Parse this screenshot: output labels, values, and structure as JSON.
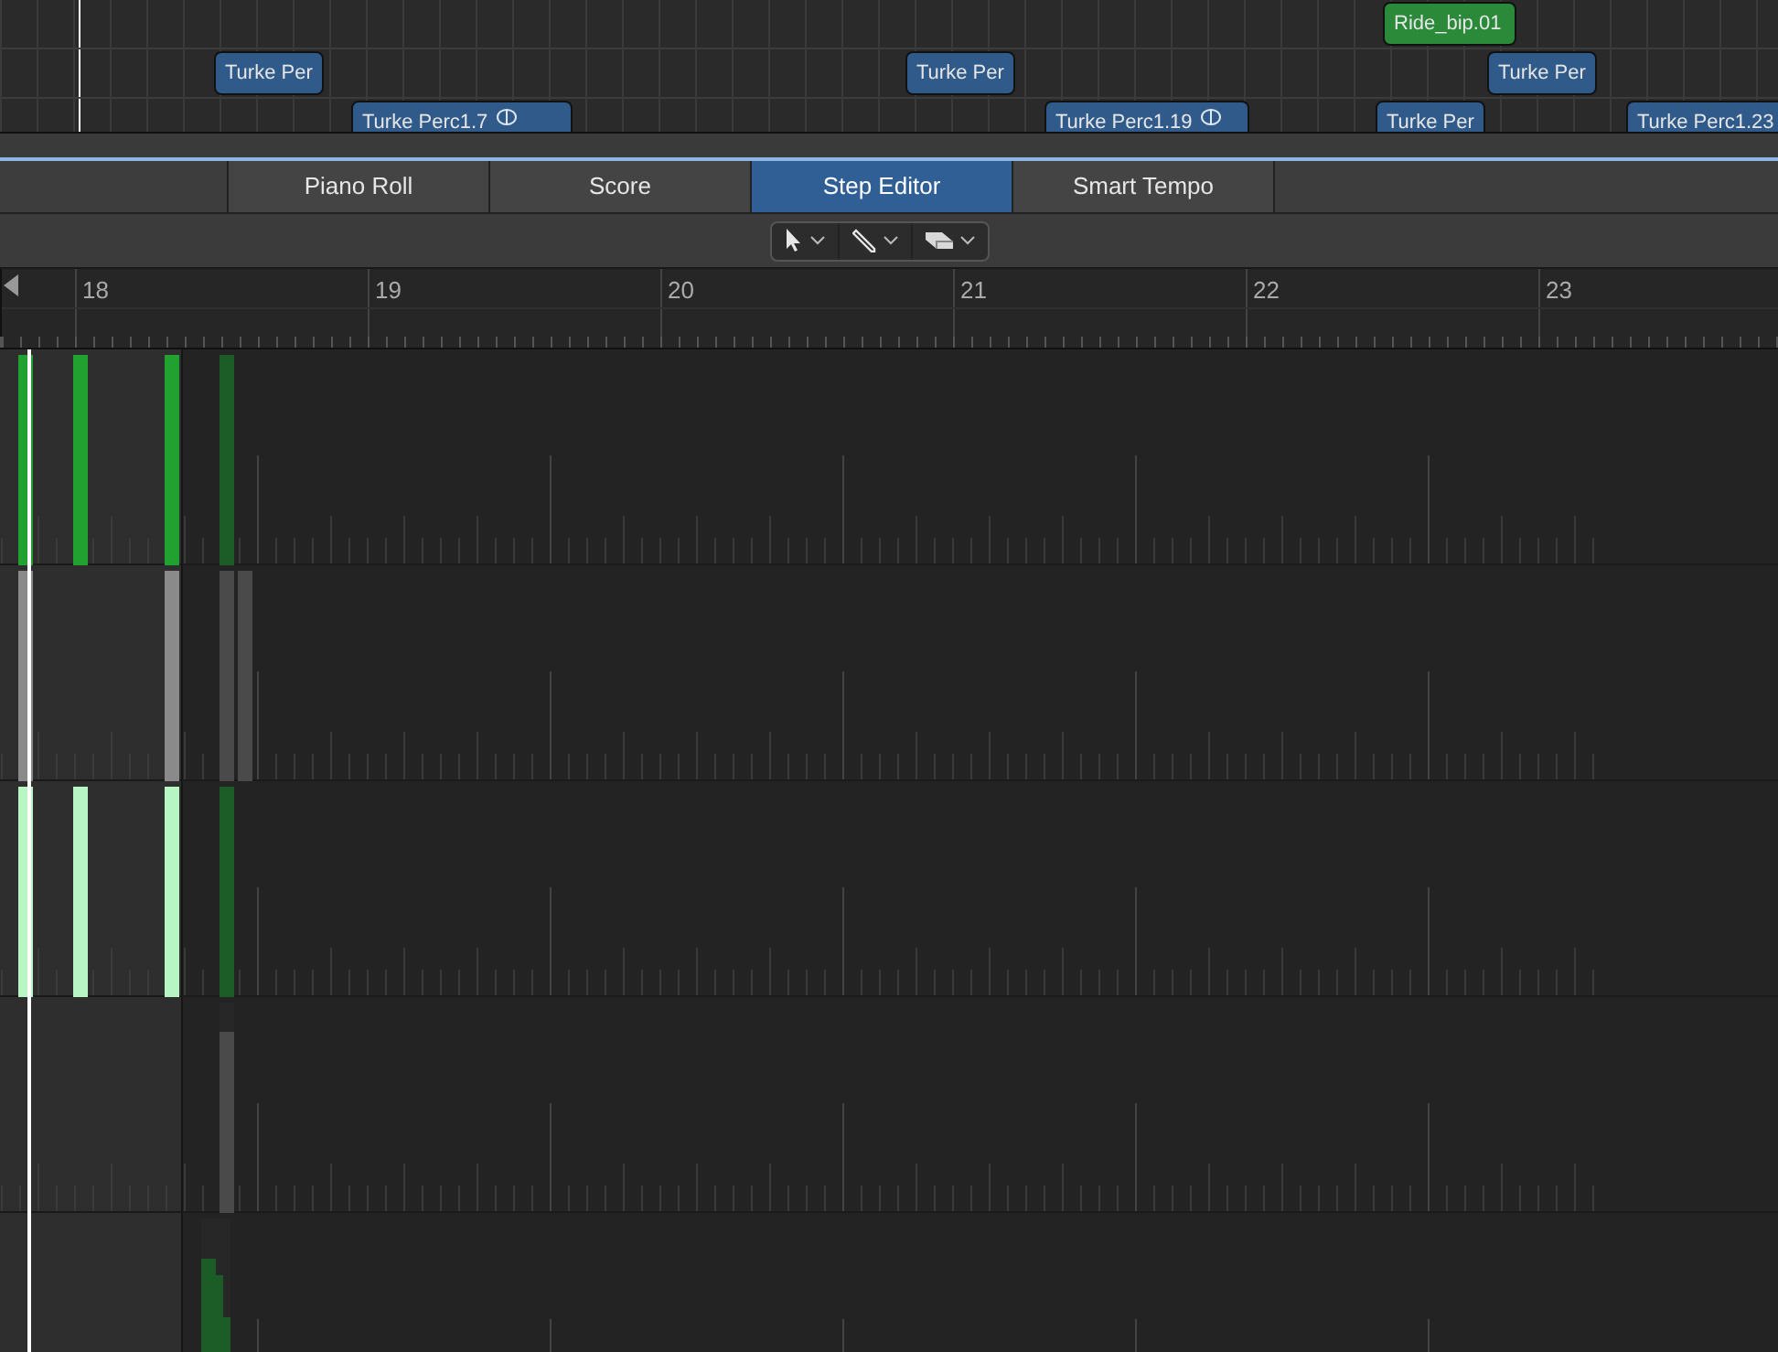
{
  "arrange_tracks": [
    {
      "regions": [
        {
          "name": "Ride_bip.01",
          "color": "#2a8a3a",
          "looped": false
        }
      ]
    },
    {
      "regions": [
        {
          "name": "Turke Per",
          "color": "#2f5a8a",
          "looped": false
        },
        {
          "name": "Turke Per",
          "color": "#2f5a8a",
          "looped": false
        },
        {
          "name": "Turke Per",
          "color": "#2f5a8a",
          "looped": false
        }
      ]
    },
    {
      "regions": [
        {
          "name": "Turke Perc1.7",
          "color": "#2f5a8a",
          "looped": true
        },
        {
          "name": "Turke Perc1.19",
          "color": "#2f5a8a",
          "looped": true
        },
        {
          "name": "Turke Per",
          "color": "#2f5a8a",
          "looped": false
        },
        {
          "name": "Turke Perc1.23",
          "color": "#2f5a8a",
          "looped": false
        }
      ]
    }
  ],
  "tabs": [
    {
      "label": "Piano Roll",
      "selected": false
    },
    {
      "label": "Score",
      "selected": false
    },
    {
      "label": "Step Editor",
      "selected": true
    },
    {
      "label": "Smart Tempo",
      "selected": false
    }
  ],
  "tools": [
    {
      "kind": "pointer"
    },
    {
      "kind": "pencil"
    },
    {
      "kind": "eraser"
    }
  ],
  "ruler": [
    "18",
    "19",
    "20",
    "21",
    "22",
    "23"
  ],
  "lanes": [
    {
      "steps": [
        {
          "level": 1,
          "color": "#21a12f"
        },
        {
          "level": 1,
          "color": "#21a12f"
        },
        {
          "level": 1,
          "color": "#21a12f"
        },
        {
          "level": 1,
          "color": "#1b5c27"
        }
      ]
    },
    {
      "steps": [
        {
          "level": 1,
          "color": "#8a8a8a"
        },
        {
          "level": 1,
          "color": "#8a8a8a"
        },
        {
          "level": 1,
          "color": "#4a4a4a"
        },
        {
          "level": 1,
          "color": "#4a4a4a"
        }
      ]
    },
    {
      "steps": [
        {
          "level": 1,
          "color": "#b8f5c4"
        },
        {
          "level": 1,
          "color": "#b8f5c4"
        },
        {
          "level": 1,
          "color": "#b8f5c4"
        },
        {
          "level": 1,
          "color": "#1b5c27"
        }
      ]
    },
    {
      "steps": [
        {
          "level": 0.86,
          "color": "#4a4a4a"
        }
      ]
    },
    {
      "steps": [
        {
          "level": 0.81,
          "color": "#1b5c27"
        },
        {
          "level": 0.73,
          "color": "#1b5c27"
        },
        {
          "level": 0.53,
          "color": "#1b5c27"
        }
      ]
    }
  ]
}
